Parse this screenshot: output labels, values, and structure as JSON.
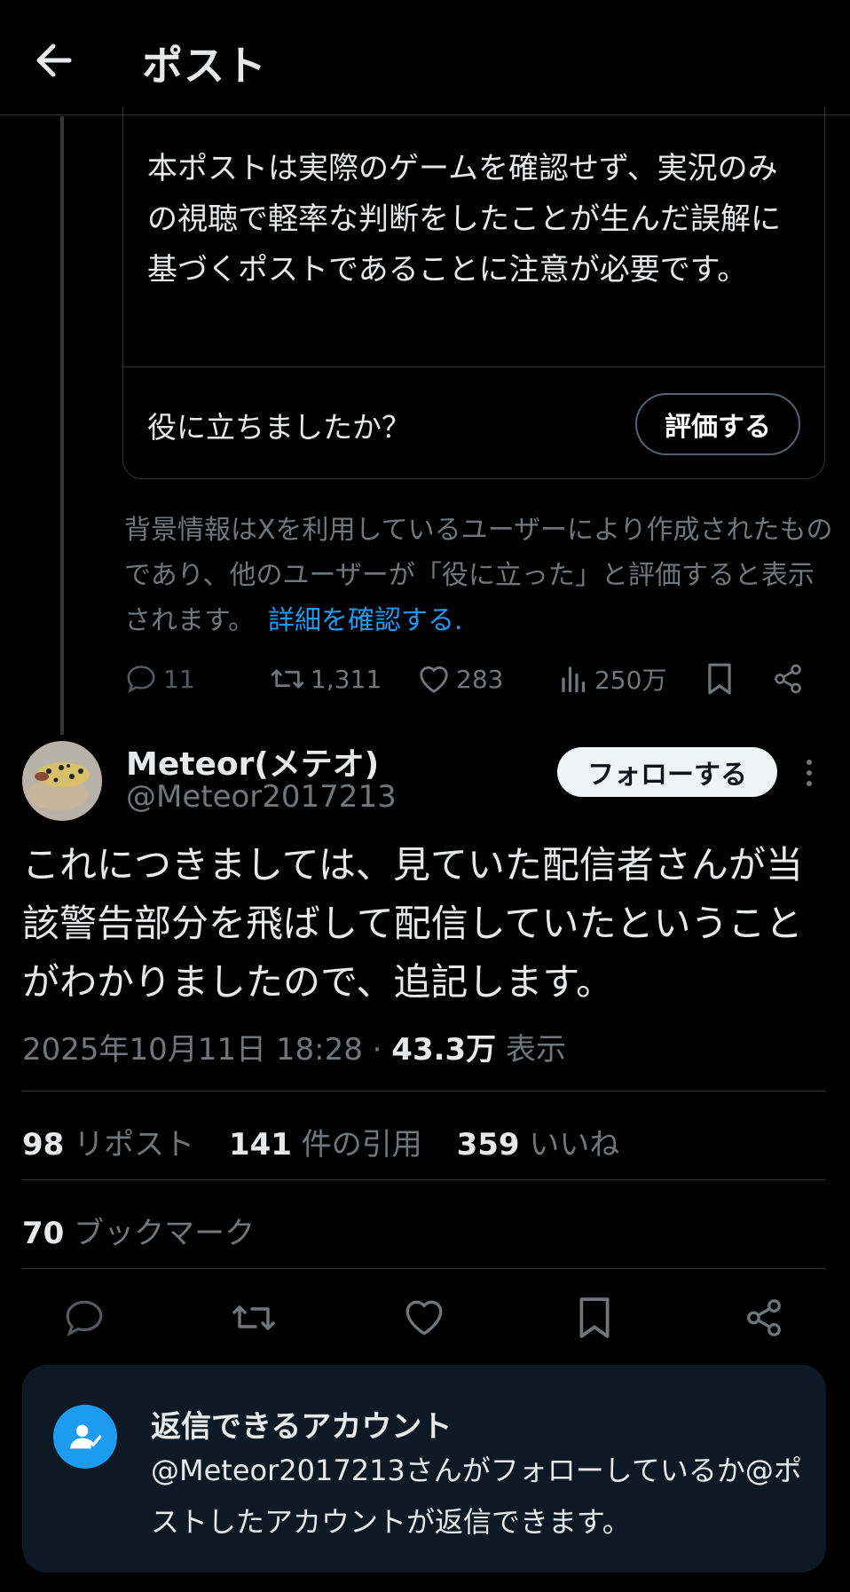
{
  "header": {
    "title": "ポスト"
  },
  "note": {
    "text": "本ポストは実際のゲームを確認せず、実況のみの視聴で軽率な判断をしたことが生んだ誤解に基づくポストであることに注意が必要です。",
    "helpful_question": "役に立ちましたか？",
    "rate_label": "評価する",
    "disclaimer": "背景情報はXを利用しているユーザーにより作成されたものであり、他のユーザーが「役に立った」と評価すると表示されます。",
    "details_link": "詳細を確認する",
    "details_suffix": "."
  },
  "prev_stats": {
    "replies": "11",
    "reposts": "1,311",
    "likes": "283",
    "views": "250万"
  },
  "post": {
    "author_name": "Meteor(メテオ)",
    "author_handle": "@Meteor2017213",
    "follow_label": "フォローする",
    "text": "これにつきましては、見ていた配信者さんが当該警告部分を飛ばして配信していたということがわかりましたので、追記します。",
    "timestamp": "2025年10月11日 18:28",
    "separator": "·",
    "views_count": "43.3万",
    "views_label": "表示",
    "repost_count": "98",
    "repost_label": "リポスト",
    "quote_count": "141",
    "quote_label": "件の引用",
    "like_count": "359",
    "like_label": "いいね",
    "bookmark_count": "70",
    "bookmark_label": "ブックマーク"
  },
  "reply_restriction": {
    "title": "返信できるアカウント",
    "body": "@Meteor2017213さんがフォローしているか@ポストしたアカウントが返信できます。"
  },
  "colors": {
    "background": "#000000",
    "text": "#e7e9ea",
    "secondary": "#71767b",
    "accent": "#1d9bf0",
    "border": "#2f3336",
    "restriction_bg": "#0d1a25"
  }
}
